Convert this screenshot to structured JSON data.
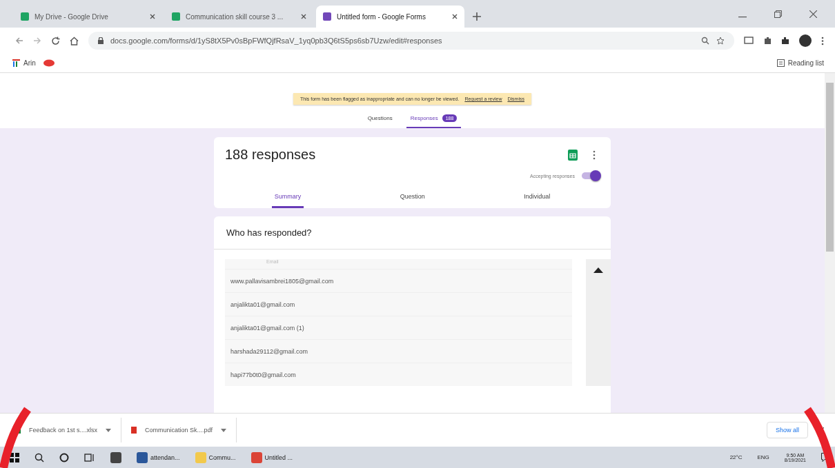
{
  "browser_tabs": [
    {
      "title": "My Drive - Google Drive",
      "kind": "drive",
      "selected": false
    },
    {
      "title": "Communication skill course 3 ...",
      "kind": "drive",
      "selected": false
    },
    {
      "title": "Untitled form - Google Forms",
      "kind": "forms",
      "selected": true
    }
  ],
  "address_bar": {
    "url": "docs.google.com/forms/d/1yS8tX5Pv0sBpFWfQjfRsaV_1yq0pb3Q6tS5ps6sb7Uzw/edit#responses"
  },
  "bookmarks": [
    {
      "label": "Arin"
    }
  ],
  "reading_list": "Reading list",
  "banner": {
    "message": "This form has been flagged as inappropriate and can no longer be viewed.",
    "links": [
      "Request a review",
      "Dismiss"
    ]
  },
  "form_tabs": [
    {
      "label": "Questions",
      "selected": false
    },
    {
      "label": "Responses",
      "selected": true,
      "badge": "188"
    }
  ],
  "summary_card": {
    "title": "188 responses",
    "toggle": {
      "label": "Accepting responses",
      "on": true
    },
    "tabs": [
      {
        "label": "Summary",
        "selected": true
      },
      {
        "label": "Question",
        "selected": false
      },
      {
        "label": "Individual",
        "selected": false
      }
    ]
  },
  "respondents": {
    "title": "Who has responded?",
    "header": "Email",
    "emails": [
      "www.pallavisambrei1805@gmail.com",
      "anjalikta01@gmail.com",
      "anjalikta01@gmail.com (1)",
      "harshada29112@gmail.com",
      "hapi77b0t0@gmail.com"
    ]
  },
  "downloads": {
    "files": [
      {
        "name": "Feedback on 1st s....xlsx",
        "kind": "sheet"
      },
      {
        "name": "Communication Sk....pdf",
        "kind": "pdf"
      }
    ],
    "show_all": "Show all"
  },
  "taskbar": {
    "apps": [
      {
        "kind": "store"
      },
      {
        "label": "attendan...",
        "kind": "word"
      },
      {
        "label": "Commu...",
        "kind": "folder"
      },
      {
        "label": "Untitled ...",
        "kind": "chrome"
      }
    ],
    "temperature": "22°C",
    "language": "ENG",
    "time": "9:50 AM",
    "date": "8/19/2021"
  }
}
